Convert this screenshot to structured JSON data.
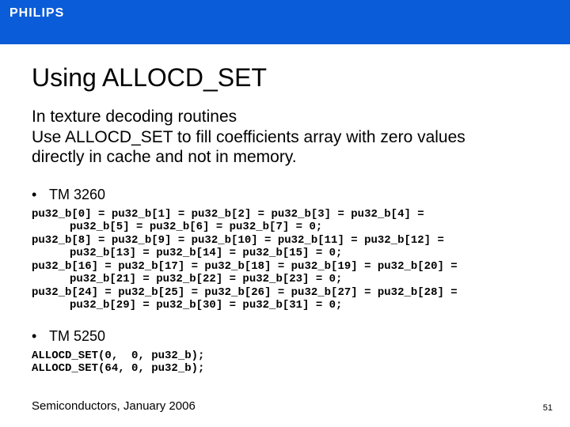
{
  "brand": {
    "wordmark": "PHILIPS",
    "bar_color": "#0b5cd8"
  },
  "title": "Using ALLOCD_SET",
  "body": {
    "line1": "In texture decoding routines",
    "line2": "Use ALLOCD_SET to fill coefficients array with zero values",
    "line3": "directly in cache and not in memory."
  },
  "sections": {
    "tm3260": {
      "label": "TM 3260",
      "code": [
        {
          "a": "pu32_b[0] = pu32_b[1] = pu32_b[2] = pu32_b[3] = pu32_b[4] =",
          "b": "pu32_b[5] = pu32_b[6] = pu32_b[7] = 0;"
        },
        {
          "a": "pu32_b[8] = pu32_b[9] = pu32_b[10] = pu32_b[11] = pu32_b[12] =",
          "b": "pu32_b[13] = pu32_b[14] = pu32_b[15] = 0;"
        },
        {
          "a": "pu32_b[16] = pu32_b[17] = pu32_b[18] = pu32_b[19] = pu32_b[20] =",
          "b": "pu32_b[21] = pu32_b[22] = pu32_b[23] = 0;"
        },
        {
          "a": "pu32_b[24] = pu32_b[25] = pu32_b[26] = pu32_b[27] = pu32_b[28] =",
          "b": "pu32_b[29] = pu32_b[30] = pu32_b[31] = 0;"
        }
      ]
    },
    "tm5250": {
      "label": "TM 5250",
      "code": [
        "ALLOCD_SET(0,  0, pu32_b);",
        "ALLOCD_SET(64, 0, pu32_b);"
      ]
    }
  },
  "footer": "Semiconductors, January 2006",
  "page_number": "51"
}
